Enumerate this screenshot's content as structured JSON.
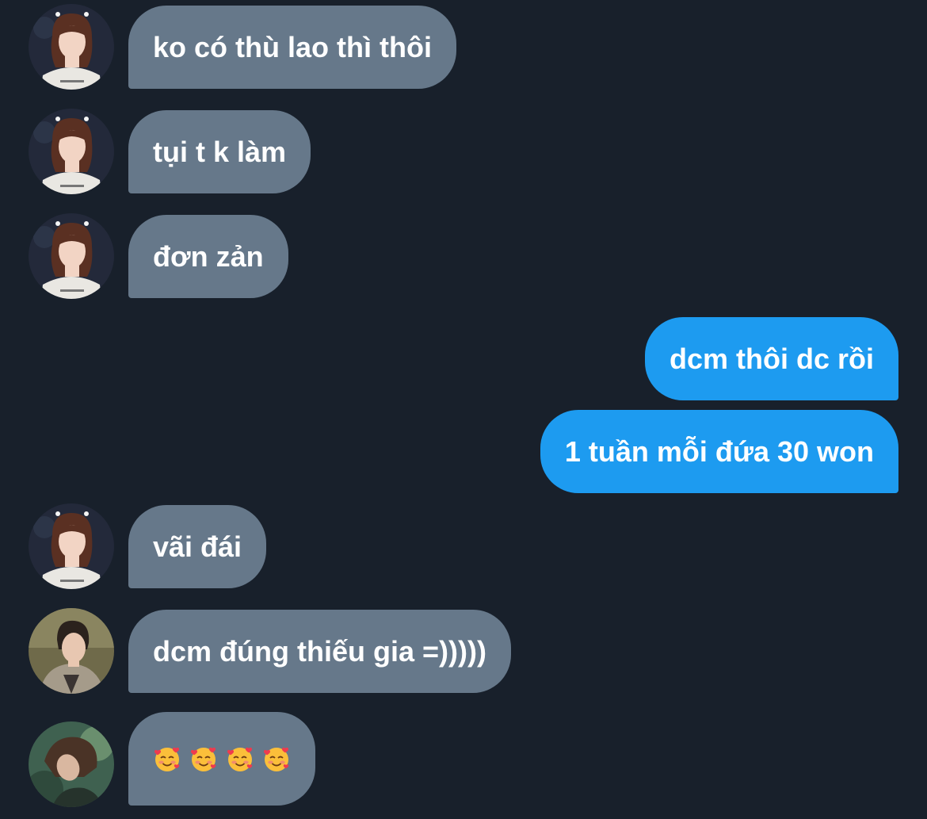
{
  "messages": [
    {
      "side": "in",
      "avatar": "avatar-a",
      "text": "ko có thù lao thì thôi"
    },
    {
      "side": "in",
      "avatar": "avatar-a",
      "text": "tụi t k làm"
    },
    {
      "side": "in",
      "avatar": "avatar-a",
      "text": "đơn zản"
    },
    {
      "side": "out",
      "text": "dcm thôi dc rồi"
    },
    {
      "side": "out",
      "text": "1 tuần mỗi đứa 30 won"
    },
    {
      "side": "in",
      "avatar": "avatar-a",
      "text": "vãi đái"
    },
    {
      "side": "in",
      "avatar": "avatar-b",
      "text": "dcm đúng thiếu gia =)))))"
    },
    {
      "side": "in",
      "avatar": "avatar-c",
      "emoji": [
        "smiling-face-with-hearts",
        "smiling-face-with-hearts",
        "smiling-face-with-hearts",
        "smiling-face-with-hearts"
      ]
    }
  ],
  "colors": {
    "background": "#18202b",
    "incoming_bubble": "#66788a",
    "outgoing_bubble": "#1d9bf0",
    "text": "#ffffff"
  }
}
